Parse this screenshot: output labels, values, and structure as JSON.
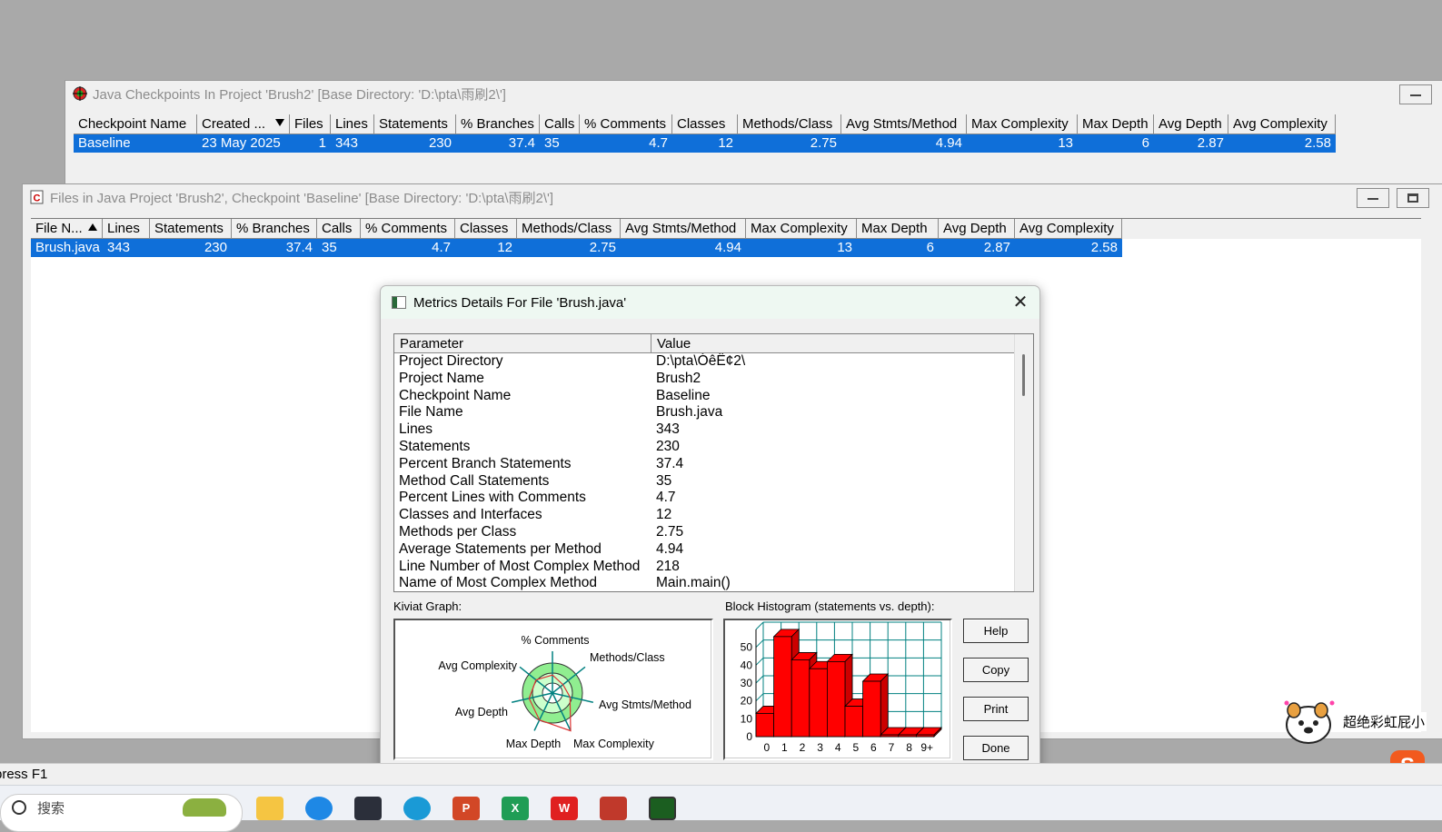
{
  "checkpoints_window": {
    "title": "Java Checkpoints In Project 'Brush2'  [Base Directory: 'D:\\pta\\雨刷2\\']",
    "columns": [
      "Checkpoint Name",
      "Created ...",
      "Files",
      "Lines",
      "Statements",
      "% Branches",
      "Calls",
      "% Comments",
      "Classes",
      "Methods/Class",
      "Avg Stmts/Method",
      "Max Complexity",
      "Max Depth",
      "Avg Depth",
      "Avg Complexity"
    ],
    "rows": [
      [
        "Baseline",
        "23 May 2025",
        "1",
        "343",
        "230",
        "37.4",
        "35",
        "4.7",
        "12",
        "2.75",
        "4.94",
        "13",
        "6",
        "2.87",
        "2.58"
      ]
    ]
  },
  "files_window": {
    "title": "Files in Java Project 'Brush2', Checkpoint 'Baseline'  [Base Directory: 'D:\\pta\\雨刷2\\']",
    "columns": [
      "File N...",
      "Lines",
      "Statements",
      "% Branches",
      "Calls",
      "% Comments",
      "Classes",
      "Methods/Class",
      "Avg Stmts/Method",
      "Max Complexity",
      "Max Depth",
      "Avg Depth",
      "Avg Complexity"
    ],
    "rows": [
      [
        "Brush.java",
        "343",
        "230",
        "37.4",
        "35",
        "4.7",
        "12",
        "2.75",
        "4.94",
        "13",
        "6",
        "2.87",
        "2.58"
      ]
    ]
  },
  "dialog": {
    "title": "Metrics Details For File 'Brush.java'",
    "close_glyph": "✕",
    "param_header": "Parameter",
    "value_header": "Value",
    "params": [
      [
        "Project Directory",
        "D:\\pta\\ÓêË¢2\\"
      ],
      [
        "Project Name",
        "Brush2"
      ],
      [
        "Checkpoint Name",
        "Baseline"
      ],
      [
        "File Name",
        "Brush.java"
      ],
      [
        "Lines",
        "343"
      ],
      [
        "Statements",
        "230"
      ],
      [
        "Percent Branch Statements",
        "37.4"
      ],
      [
        "Method Call Statements",
        "35"
      ],
      [
        "Percent Lines with Comments",
        "4.7"
      ],
      [
        "Classes and Interfaces",
        "12"
      ],
      [
        "Methods per Class",
        "2.75"
      ],
      [
        "Average Statements per Method",
        "4.94"
      ],
      [
        "Line Number of Most Complex Method",
        "218"
      ],
      [
        "Name of Most Complex Method",
        "Main.main()"
      ]
    ],
    "kiviat_label": "Kiviat Graph:",
    "histogram_label": "Block Histogram (statements vs. depth):",
    "buttons": {
      "help": "Help",
      "copy": "Copy",
      "print": "Print",
      "done": "Done"
    }
  },
  "kiviat": {
    "axes": [
      "% Comments",
      "Methods/Class",
      "Avg Stmts/Method",
      "Max Complexity",
      "Max Depth",
      "Avg Depth",
      "Avg Complexity"
    ]
  },
  "chart_data": {
    "type": "bar",
    "categories": [
      "0",
      "1",
      "2",
      "3",
      "4",
      "5",
      "6",
      "7",
      "8",
      "9+"
    ],
    "values": [
      13,
      56,
      43,
      38,
      42,
      17,
      31,
      1,
      1,
      1
    ],
    "ylim": [
      0,
      60
    ],
    "yticks": [
      0,
      10,
      20,
      30,
      40,
      50
    ],
    "bar_color": "#ff0000",
    "grid_color": "#008080"
  },
  "status": {
    "text": "press F1"
  },
  "taskbar": {
    "search_placeholder": "搜索"
  },
  "notification": {
    "text": "超绝彩虹屁小"
  }
}
